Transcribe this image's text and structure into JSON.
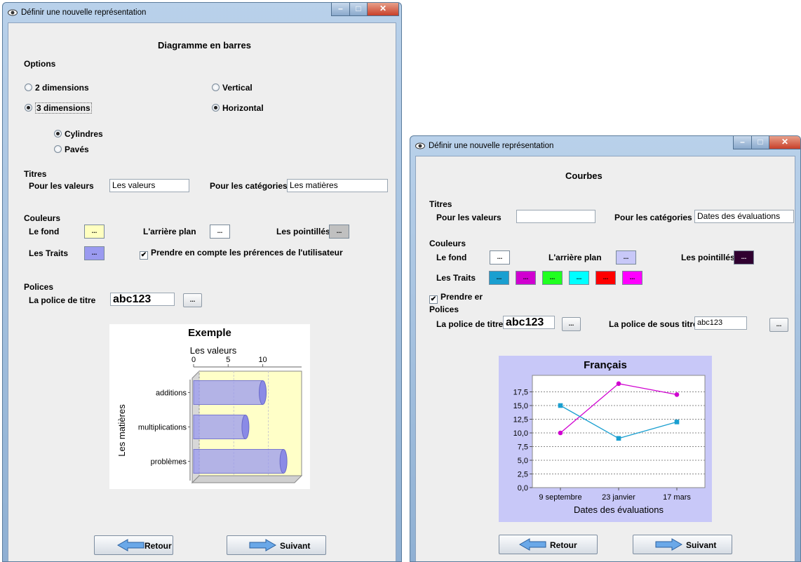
{
  "left": {
    "window_title": "Définir une nouvelle représentation",
    "heading": "Diagramme en barres",
    "options_label": "Options",
    "radio_2d": "2 dimensions",
    "radio_3d": "3 dimensions",
    "radio_vertical": "Vertical",
    "radio_horizontal": "Horizontal",
    "radio_cylindres": "Cylindres",
    "radio_paves": "Pavés",
    "titres_label": "Titres",
    "pour_valeurs": "Pour les valeurs",
    "valeurs_value": "Les valeurs",
    "pour_categories": "Pour les catégories",
    "categories_value": "Les matières",
    "couleurs_label": "Couleurs",
    "le_fond": "Le fond",
    "arriere_plan": "L'arrière plan",
    "pointilles": "Les pointillés",
    "les_traits": "Les Traits",
    "prendre_compte": "Prendre en compte les prérences de  l'utilisateur",
    "polices_label": "Polices",
    "police_titre": "La police de titre",
    "police_titre_value": "abc123",
    "ellipsis": "...",
    "retour": "Retour",
    "suivant": "Suivant",
    "colors": {
      "fond": "#ffffc0",
      "arriere": "#ffffff",
      "pointilles": "#c0c0c0",
      "traits": "#9a9af0"
    }
  },
  "right": {
    "window_title": "Définir une nouvelle représentation",
    "heading": "Courbes",
    "titres_label": "Titres",
    "pour_valeurs": "Pour les valeurs",
    "valeurs_value": "",
    "pour_categories": "Pour les catégories",
    "categories_value": "Dates des évaluations",
    "couleurs_label": "Couleurs",
    "le_fond": "Le fond",
    "arriere_plan": "L'arrière plan",
    "pointilles": "Les pointillés",
    "les_traits": "Les Traits",
    "prendre_compte": "Prendre er",
    "polices_label": "Polices",
    "police_titre": "La police de titre",
    "police_titre_value": "abc123",
    "police_sous_titre": "La police de sous titre",
    "police_sous_titre_value": "abc123",
    "ellipsis": "...",
    "retour": "Retour",
    "suivant": "Suivant",
    "colors": {
      "fond": "#ffffff",
      "arriere": "#c8c8f8",
      "pointilles": "#300030",
      "traits": [
        "#1a9fd0",
        "#d000d0",
        "#20ff20",
        "#00ffff",
        "#ff0000",
        "#ff00ff"
      ]
    }
  },
  "chart_data": [
    {
      "type": "bar",
      "orientation": "horizontal",
      "title": "Exemple",
      "xlabel": "Les valeurs",
      "ylabel": "Les matières",
      "categories": [
        "additions",
        "multiplications",
        "problèmes"
      ],
      "values": [
        10,
        7.5,
        13
      ],
      "xticks": [
        "0",
        "5",
        "10"
      ],
      "xlim": [
        0,
        14
      ],
      "colors": {
        "bar": "#9a9af0",
        "plot_bg": "#ffffc8"
      }
    },
    {
      "type": "line",
      "title": "Français",
      "xlabel": "Dates des évaluations",
      "categories": [
        "9 septembre",
        "23 janvier",
        "17 mars"
      ],
      "series": [
        {
          "values": [
            10,
            19,
            17
          ],
          "color": "#d000d0"
        },
        {
          "values": [
            15,
            9,
            12
          ],
          "color": "#1a9fd0"
        }
      ],
      "yticks": [
        "0,0",
        "2,5",
        "5,0",
        "7,5",
        "10,0",
        "12,5",
        "15,0",
        "17,5"
      ],
      "ylim": [
        0,
        20
      ],
      "grid": true,
      "colors": {
        "outer_bg": "#c8c8f8",
        "plot_bg": "#ffffff"
      }
    }
  ]
}
